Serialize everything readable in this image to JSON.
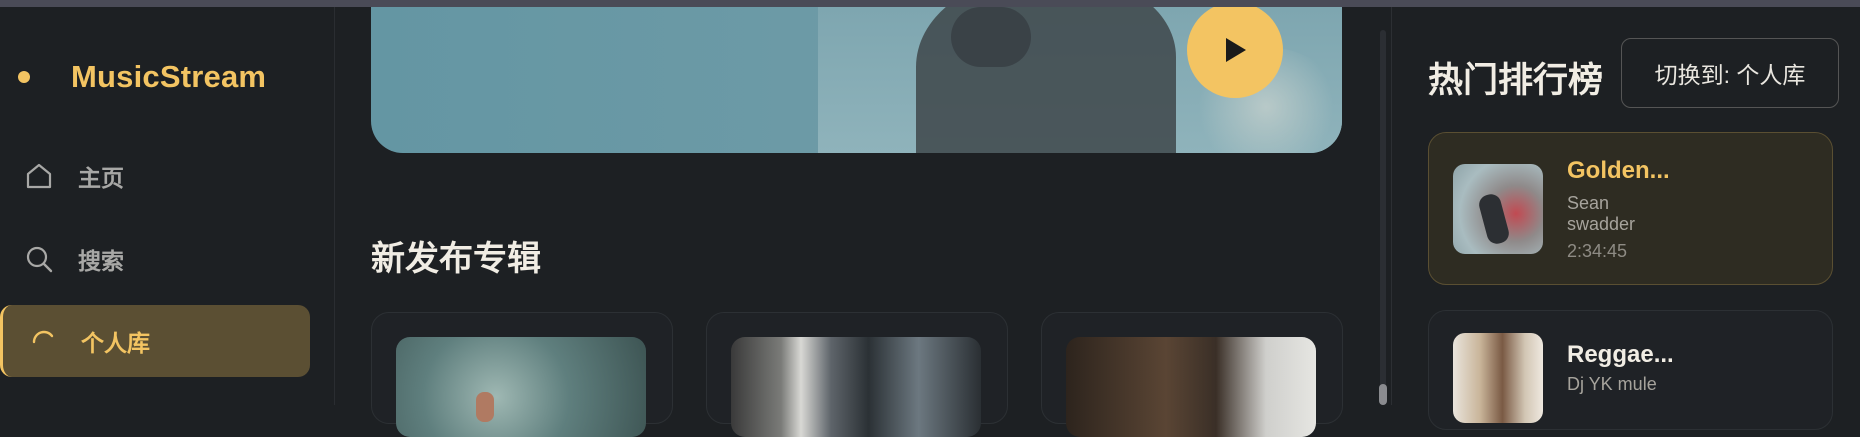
{
  "app": {
    "name": "MusicStream"
  },
  "sidebar": {
    "items": [
      {
        "label": "主页",
        "icon": "home-icon"
      },
      {
        "label": "搜索",
        "icon": "search-icon"
      },
      {
        "label": "个人库",
        "icon": "library-icon",
        "active": true
      }
    ]
  },
  "main": {
    "section_title": "新发布专辑"
  },
  "right_panel": {
    "title": "热门排行榜",
    "switch_label": "切换到: 个人库",
    "tracks": [
      {
        "title": "Golden...",
        "artist": "Sean swadder",
        "duration": "2:34:45"
      },
      {
        "title": "Reggae...",
        "artist": "Dj YK mule"
      }
    ]
  },
  "colors": {
    "accent": "#f3c462",
    "background": "#1d2023",
    "active_nav_bg": "#5b4f33",
    "active_card_bg": "#2e2c22"
  }
}
